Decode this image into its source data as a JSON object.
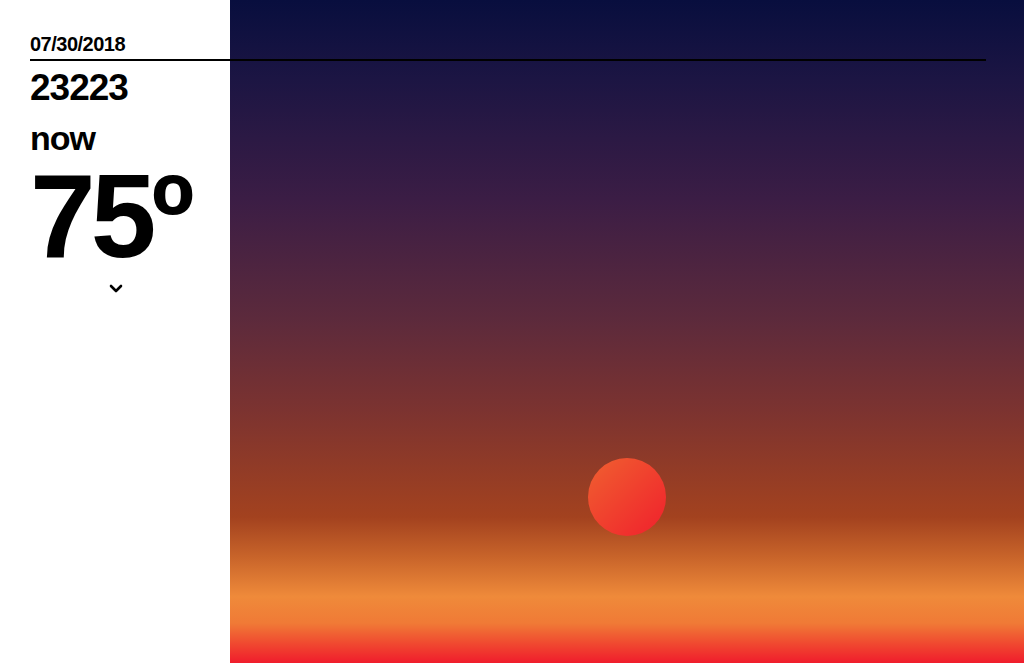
{
  "date": "07/30/2018",
  "location": {
    "zip": "23223"
  },
  "current": {
    "label": "now",
    "temperature": "75º"
  }
}
